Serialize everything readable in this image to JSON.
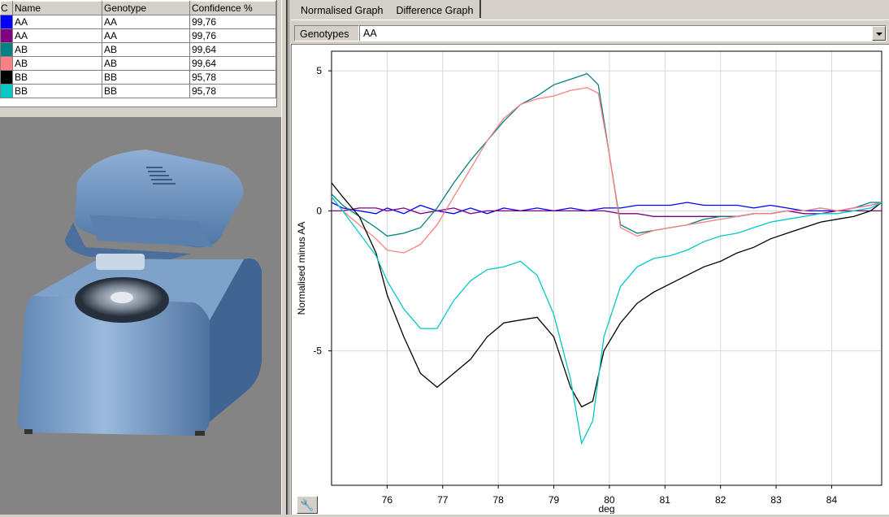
{
  "results_table": {
    "headers": {
      "color": "C",
      "name": "Name",
      "genotype": "Genotype",
      "confidence": "Confidence %"
    },
    "rows": [
      {
        "color": "#0000ff",
        "name": "AA",
        "genotype": "AA",
        "confidence": "99,76"
      },
      {
        "color": "#800080",
        "name": "AA",
        "genotype": "AA",
        "confidence": "99,76"
      },
      {
        "color": "#008080",
        "name": "AB",
        "genotype": "AB",
        "confidence": "99,64"
      },
      {
        "color": "#ff8080",
        "name": "AB",
        "genotype": "AB",
        "confidence": "99,64"
      },
      {
        "color": "#000000",
        "name": "BB",
        "genotype": "BB",
        "confidence": "95,78"
      },
      {
        "color": "#00c8c8",
        "name": "BB",
        "genotype": "BB",
        "confidence": "95,78"
      }
    ]
  },
  "tabs": [
    {
      "label": "Normalised Graph",
      "active": false
    },
    {
      "label": "Difference Graph",
      "active": true
    }
  ],
  "genotypes": {
    "label": "Genotypes",
    "selected": "AA"
  },
  "chart_data": {
    "type": "line",
    "xlabel": "deg",
    "ylabel": "Normalised minus AA",
    "xlim": [
      75.0,
      84.9
    ],
    "ylim": [
      -9.8,
      5.7
    ],
    "xticks": [
      76,
      77,
      78,
      79,
      80,
      81,
      82,
      83,
      84
    ],
    "yticks": [
      5,
      0,
      -5
    ],
    "grid": true,
    "series": [
      {
        "color": "#0000ff",
        "x": [
          75.0,
          75.2,
          75.5,
          75.8,
          76.0,
          76.3,
          76.6,
          76.9,
          77.2,
          77.5,
          77.8,
          78.1,
          78.4,
          78.7,
          79.0,
          79.3,
          79.6,
          79.9,
          80.2,
          80.5,
          80.8,
          81.1,
          81.4,
          81.7,
          82.0,
          82.3,
          82.6,
          82.9,
          83.2,
          83.5,
          83.8,
          84.1,
          84.4,
          84.7,
          84.9
        ],
        "y": [
          0.3,
          0.1,
          0.0,
          -0.1,
          0.1,
          -0.1,
          0.2,
          0.0,
          -0.1,
          0.1,
          -0.1,
          0.1,
          0.0,
          0.1,
          0.0,
          0.1,
          0.0,
          0.1,
          0.1,
          0.2,
          0.2,
          0.2,
          0.3,
          0.2,
          0.2,
          0.2,
          0.1,
          0.2,
          0.1,
          0.0,
          0.0,
          0.0,
          0.1,
          0.2,
          0.3
        ]
      },
      {
        "color": "#800080",
        "x": [
          75.0,
          75.2,
          75.5,
          75.8,
          76.0,
          76.3,
          76.6,
          76.9,
          77.2,
          77.5,
          77.8,
          78.1,
          78.4,
          78.7,
          79.0,
          79.3,
          79.6,
          79.9,
          80.2,
          80.5,
          80.8,
          81.1,
          81.4,
          81.7,
          82.0,
          82.3,
          82.6,
          82.9,
          83.2,
          83.5,
          83.8,
          84.1,
          84.4,
          84.7,
          84.9
        ],
        "y": [
          0.0,
          0.0,
          0.1,
          0.1,
          0.0,
          0.1,
          -0.1,
          0.0,
          0.1,
          -0.1,
          0.0,
          0.0,
          0.0,
          0.0,
          0.0,
          0.0,
          0.0,
          0.0,
          -0.1,
          -0.1,
          -0.2,
          -0.2,
          -0.2,
          -0.2,
          -0.2,
          -0.2,
          -0.1,
          -0.1,
          0.0,
          -0.1,
          -0.1,
          0.0,
          0.0,
          0.0,
          0.0
        ]
      },
      {
        "color": "#008080",
        "x": [
          75.0,
          75.2,
          75.5,
          75.8,
          76.0,
          76.3,
          76.6,
          76.9,
          77.2,
          77.5,
          77.8,
          78.1,
          78.4,
          78.7,
          79.0,
          79.3,
          79.6,
          79.8,
          80.0,
          80.2,
          80.5,
          80.8,
          81.1,
          81.4,
          81.7,
          82.0,
          82.3,
          82.6,
          82.9,
          83.2,
          83.5,
          83.8,
          84.1,
          84.4,
          84.7,
          84.9
        ],
        "y": [
          0.6,
          0.2,
          -0.2,
          -0.6,
          -0.9,
          -0.8,
          -0.6,
          0.1,
          1.0,
          1.8,
          2.5,
          3.2,
          3.8,
          4.1,
          4.5,
          4.7,
          4.9,
          4.5,
          2.0,
          -0.5,
          -0.8,
          -0.7,
          -0.6,
          -0.5,
          -0.3,
          -0.2,
          -0.2,
          -0.1,
          -0.1,
          0.0,
          0.0,
          0.1,
          0.0,
          0.1,
          0.3,
          0.3
        ]
      },
      {
        "color": "#ff8080",
        "x": [
          75.0,
          75.2,
          75.5,
          75.8,
          76.0,
          76.3,
          76.6,
          76.9,
          77.2,
          77.5,
          77.8,
          78.1,
          78.4,
          78.7,
          79.0,
          79.3,
          79.6,
          79.8,
          80.0,
          80.2,
          80.5,
          80.8,
          81.1,
          81.4,
          81.7,
          82.0,
          82.3,
          82.6,
          82.9,
          83.2,
          83.5,
          83.8,
          84.1,
          84.4,
          84.7,
          84.9
        ],
        "y": [
          0.5,
          0.0,
          -0.5,
          -1.0,
          -1.4,
          -1.5,
          -1.2,
          -0.5,
          0.5,
          1.5,
          2.5,
          3.3,
          3.8,
          4.0,
          4.1,
          4.3,
          4.4,
          4.2,
          2.0,
          -0.6,
          -0.9,
          -0.7,
          -0.6,
          -0.5,
          -0.4,
          -0.3,
          -0.2,
          -0.1,
          -0.1,
          0.0,
          0.0,
          0.1,
          0.0,
          0.1,
          0.2,
          0.3
        ]
      },
      {
        "color": "#000000",
        "x": [
          75.0,
          75.2,
          75.5,
          75.8,
          76.0,
          76.3,
          76.6,
          76.9,
          77.2,
          77.5,
          77.8,
          78.1,
          78.4,
          78.7,
          79.0,
          79.3,
          79.5,
          79.7,
          79.9,
          80.2,
          80.5,
          80.8,
          81.1,
          81.4,
          81.7,
          82.0,
          82.3,
          82.6,
          82.9,
          83.2,
          83.5,
          83.8,
          84.1,
          84.4,
          84.7,
          84.9
        ],
        "y": [
          1.0,
          0.5,
          -0.2,
          -1.5,
          -3.0,
          -4.5,
          -5.8,
          -6.3,
          -5.8,
          -5.3,
          -4.5,
          -4.0,
          -3.9,
          -3.8,
          -4.5,
          -6.3,
          -7.0,
          -6.8,
          -5.0,
          -4.0,
          -3.3,
          -2.9,
          -2.6,
          -2.3,
          -2.0,
          -1.8,
          -1.5,
          -1.3,
          -1.0,
          -0.8,
          -0.6,
          -0.4,
          -0.3,
          -0.2,
          0.0,
          0.3
        ]
      },
      {
        "color": "#00c8c8",
        "x": [
          75.0,
          75.2,
          75.5,
          75.8,
          76.0,
          76.3,
          76.6,
          76.9,
          77.2,
          77.5,
          77.8,
          78.1,
          78.4,
          78.7,
          79.0,
          79.3,
          79.5,
          79.7,
          79.9,
          80.2,
          80.5,
          80.8,
          81.1,
          81.4,
          81.7,
          82.0,
          82.3,
          82.6,
          82.9,
          83.2,
          83.5,
          83.8,
          84.1,
          84.4,
          84.7,
          84.9
        ],
        "y": [
          0.5,
          0.0,
          -0.8,
          -1.6,
          -2.5,
          -3.5,
          -4.2,
          -4.2,
          -3.2,
          -2.5,
          -2.1,
          -2.0,
          -1.8,
          -2.3,
          -3.7,
          -6.0,
          -8.3,
          -7.5,
          -4.5,
          -2.7,
          -2.0,
          -1.7,
          -1.6,
          -1.4,
          -1.1,
          -0.9,
          -0.8,
          -0.6,
          -0.4,
          -0.3,
          -0.2,
          -0.1,
          -0.1,
          0.0,
          0.1,
          0.3
        ]
      }
    ]
  }
}
